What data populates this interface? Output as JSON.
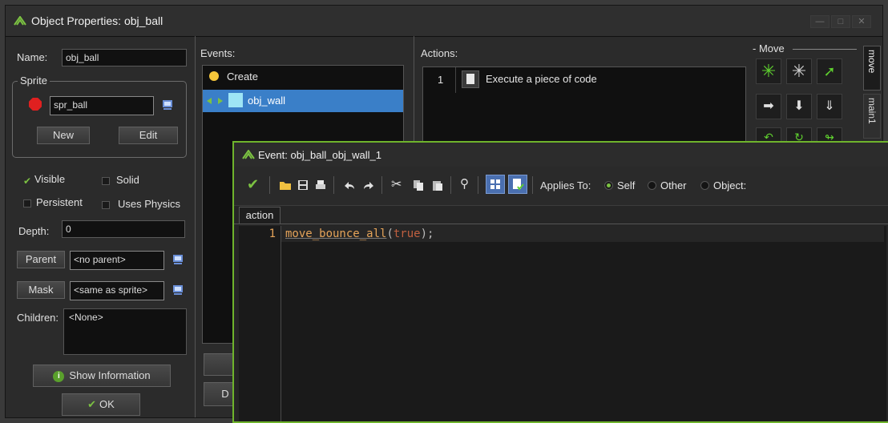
{
  "window": {
    "title": "Object Properties: obj_ball"
  },
  "left": {
    "name_label": "Name:",
    "name_value": "obj_ball",
    "sprite_group": "Sprite",
    "sprite_value": "spr_ball",
    "new_label": "New",
    "edit_label": "Edit",
    "visible_label": "Visible",
    "solid_label": "Solid",
    "persistent_label": "Persistent",
    "physics_label": "Uses Physics",
    "depth_label": "Depth:",
    "depth_value": "0",
    "parent_label": "Parent",
    "parent_value": "<no parent>",
    "mask_label": "Mask",
    "mask_value": "<same as sprite>",
    "children_label": "Children:",
    "children_value": "<None>",
    "show_info_label": "Show Information",
    "ok_label": "OK"
  },
  "events": {
    "label": "Events:",
    "items": [
      {
        "label": "Create",
        "icon": "lightbulb-icon"
      },
      {
        "label": "obj_wall",
        "icon": "collision-icon",
        "selected": true
      }
    ],
    "bottom_button": "D"
  },
  "actions": {
    "label": "Actions:",
    "items": [
      {
        "index": "1",
        "label": "Execute a piece of code",
        "icon": "code-page-icon"
      }
    ]
  },
  "move_panel": {
    "group_label": "Move",
    "tabs": [
      "move",
      "main1"
    ]
  },
  "editor": {
    "title": "Event: obj_ball_obj_wall_1",
    "applies_to_label": "Applies To:",
    "radio_self": "Self",
    "radio_other": "Other",
    "radio_object": "Object:",
    "tab": "action",
    "line_number": "1",
    "code_func": "move_bounce_all",
    "code_paren_open": "(",
    "code_arg": "true",
    "code_rest": ");"
  },
  "colors": {
    "accent_green": "#6fb42c",
    "selection": "#3a7fc8",
    "code_func": "#e5a45a",
    "code_keyword": "#c06040"
  }
}
